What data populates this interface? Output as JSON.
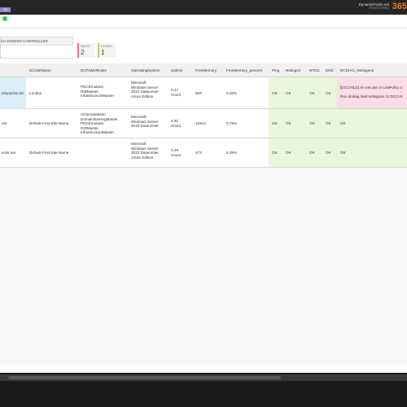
{
  "topbar": {
    "tag": "OK",
    "brand_name": "DynamicPacks.net",
    "brand_sub": "REGISTERED",
    "logo": "365"
  },
  "toolbar": {
    "status_color": "#3cc24a"
  },
  "selector": {
    "label": "CH DOMAIN CONTROLLER",
    "value": ""
  },
  "tiles": {
    "failed_label": "FAILED",
    "failed_value": "2",
    "passed_label": "PASSED",
    "passed_value": "1"
  },
  "table": {
    "headers": {
      "dc_site_name": "DCSiteName",
      "dc_fsmo_roles": "DCFSMORoles",
      "operating_system": "OperatingSystem",
      "uptime": "Uptime",
      "free_memory": "FreeMemory",
      "free_memory_percent": "FreeMemory_percent",
      "ping": "Ping",
      "netlogon": "Netlogon",
      "ntds": "NTDS",
      "dns": "DNS",
      "dcdiag_netlogons": "DCDIAG_Netlogons"
    },
    "rows": [
      {
        "name": "micpacks.net",
        "site": "London",
        "roles": "PDCEmulator,\nRIDMaster,\nInfrastructureMaster",
        "os": "Microsoft\nWindows Server\n2022 Datacenter\nAzure Edition",
        "uptime": "0.47\nHours",
        "free_memory": "559",
        "free_memory_percent": "0.28%",
        "ping": "OK",
        "netlogon": "OK",
        "ntds": "OK",
        "dns": "OK",
        "dcdiag": "[DCCHILD] An net use or LsaPolicy o\n\nRun dcdiag /test:netlogons /U:DCCHI"
      },
      {
        "name": "net",
        "site": "Default-First-Site-Name",
        "roles": "SchemaMaster,\nDomainNamingMaster,\nPDCEmulator,\nRIDMaster,\nInfrastructureMaster",
        "os": "Microsoft\nWindows Server\n2019 Datacenter",
        "uptime": "0.92\nHours",
        "free_memory": "12914",
        "free_memory_percent": "0.79%",
        "ping": "OK",
        "netlogon": "OK",
        "ntds": "OK",
        "dns": "OK",
        "dcdiag": "OK"
      },
      {
        "name": "acks.net",
        "site": "Default-First-Site-Name",
        "roles": "",
        "os": "Microsoft\nWindows Server\n2022 Datacenter\nAzure Edition",
        "uptime": "0.49\nHours",
        "free_memory": "573",
        "free_memory_percent": "0.29%",
        "ping": "OK",
        "netlogon": "OK",
        "ntds": "OK",
        "dns": "OK",
        "dcdiag": "OK"
      }
    ]
  },
  "colors": {
    "ok_cell": "#eaf6dc",
    "error_cell": "#fadde6",
    "selected_cell": "#d9eef7",
    "failed_accent": "#e36ba0",
    "passed_accent": "#a9d36d",
    "logo_accent": "#f07a1a"
  }
}
